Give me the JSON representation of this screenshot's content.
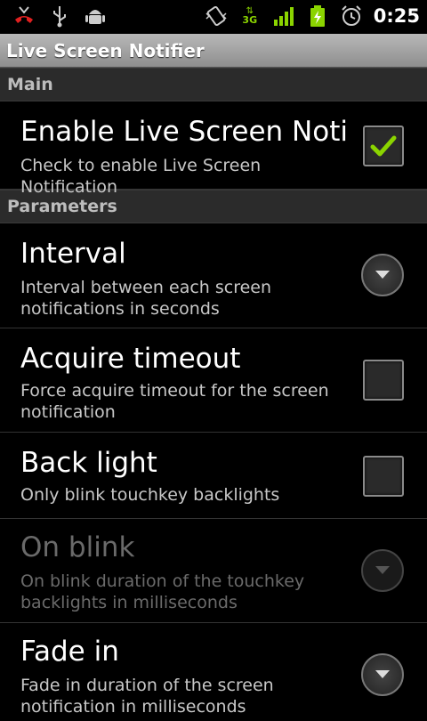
{
  "status_bar": {
    "time": "0:25",
    "network_label": "3G",
    "icons": [
      "missed-call-icon",
      "usb-icon",
      "android-debug-icon",
      "vibrate-icon",
      "network-3g-icon",
      "signal-icon",
      "battery-charging-icon",
      "alarm-icon"
    ],
    "accent": "#8bd400"
  },
  "titlebar": {
    "title": "Live Screen Notifier"
  },
  "sections": {
    "main": "Main",
    "parameters": "Parameters"
  },
  "items": {
    "enable": {
      "title": "Enable Live Screen Notification",
      "summary": "Check to enable Live Screen Notification",
      "checked": true
    },
    "interval": {
      "title": "Interval",
      "summary": "Interval between each screen notifications in seconds"
    },
    "acquire": {
      "title": "Acquire timeout",
      "summary": "Force acquire timeout for the screen notification",
      "checked": false
    },
    "backlight": {
      "title": "Back light",
      "summary": "Only blink touchkey backlights",
      "checked": false
    },
    "onblink": {
      "title": "On blink",
      "summary": "On blink duration of the touchkey backlights in milliseconds",
      "enabled": false
    },
    "fadein": {
      "title": "Fade in",
      "summary": "Fade in duration of the screen notification in milliseconds"
    }
  }
}
